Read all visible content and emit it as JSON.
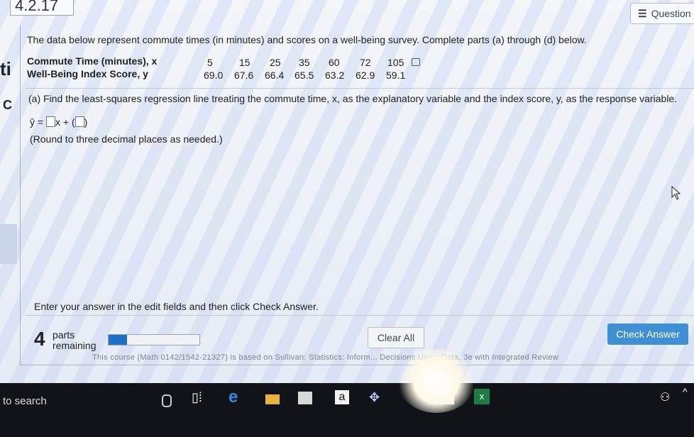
{
  "header": {
    "problem_number": "4.2.17",
    "question_button_label": "Question"
  },
  "left_edge": {
    "fragment_top": "ti",
    "fragment_mid": "C"
  },
  "problem": {
    "intro": "The data below represent commute times (in minutes) and scores on a well-being survey. Complete parts (a) through (d) below.",
    "row_x_label": "Commute Time (minutes), x",
    "row_y_label": "Well-Being Index Score, y",
    "x_values": [
      "5",
      "15",
      "25",
      "35",
      "60",
      "72",
      "105"
    ],
    "y_values": [
      "69.0",
      "67.6",
      "66.4",
      "65.5",
      "63.2",
      "62.9",
      "59.1"
    ]
  },
  "part_a": {
    "prompt": "(a) Find the least-squares regression line treating the commute time, x, as the explanatory variable and the index score, y, as the response variable.",
    "equation_lhs": "ŷ =",
    "equation_mid": "x +",
    "round_note": "(Round to three decimal places as needed.)"
  },
  "footer": {
    "instructions": "Enter your answer in the edit fields and then click Check Answer.",
    "parts_count": "4",
    "parts_label_line1": "parts",
    "parts_label_line2": "remaining",
    "progress_fraction": 0.2,
    "clear_all_label": "Clear All",
    "check_answer_label": "Check Answer",
    "course_text": "This course (Math 0142/1542-21327) is based on Sullivan: Statistics: Inform... Decisions Using Data, 3e with Integrated Review"
  },
  "taskbar": {
    "search_text": "to search",
    "icons": [
      "microphone-icon",
      "task-view-icon",
      "edge-icon",
      "file-explorer-icon",
      "store-icon",
      "amazon-icon",
      "dropbox-icon",
      "photos-icon",
      "excel-icon",
      "people-icon",
      "chevron-up-icon"
    ],
    "amazon_glyph": "a",
    "excel_glyph": "x"
  },
  "colors": {
    "accent": "#3f8fd4",
    "progress": "#1f6fc5",
    "taskbar": "#101418"
  }
}
